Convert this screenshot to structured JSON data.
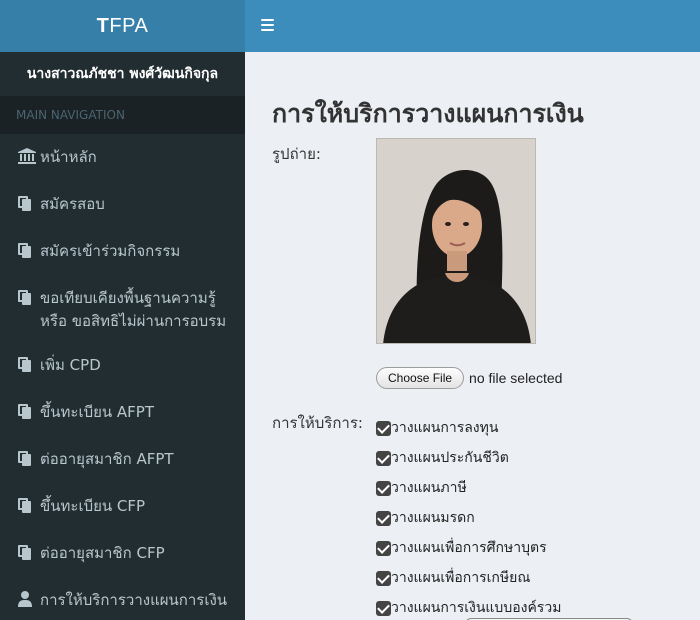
{
  "brand": {
    "first": "T",
    "rest": "FPA"
  },
  "user": {
    "name": "นางสาวณภัชชา พงศ์วัฒนกิจกุล"
  },
  "nav": {
    "header": "MAIN NAVIGATION",
    "items": [
      {
        "icon": "bank-icon",
        "label": "หน้าหลัก"
      },
      {
        "icon": "document-icon",
        "label": "สมัครสอบ"
      },
      {
        "icon": "document-icon",
        "label": "สมัครเข้าร่วมกิจกรรม"
      },
      {
        "icon": "document-icon",
        "label_line1": "ขอเทียบเคียงพื้นฐานความรู้",
        "label_line2": "หรือ ขอสิทธิไม่ผ่านการอบรม"
      },
      {
        "icon": "document-icon",
        "label": "เพิ่ม CPD"
      },
      {
        "icon": "document-icon",
        "label": "ขึ้นทะเบียน AFPT"
      },
      {
        "icon": "document-icon",
        "label": "ต่ออายุสมาชิก AFPT"
      },
      {
        "icon": "document-icon",
        "label": "ขึ้นทะเบียน CFP"
      },
      {
        "icon": "document-icon",
        "label": "ต่ออายุสมาชิก CFP"
      },
      {
        "icon": "user-icon",
        "label": "การให้บริการวางแผนการเงิน"
      }
    ]
  },
  "page": {
    "title": "การให้บริการวางแผนการเงิน",
    "photo_label": "รูปถ่าย:",
    "file_button": "Choose File",
    "file_status": "no file selected",
    "services_label": "การให้บริการ:",
    "services": [
      {
        "label": "วางแผนการลงทุน",
        "checked": true
      },
      {
        "label": "วางแผนประกันชีวิต",
        "checked": true
      },
      {
        "label": "วางแผนภาษี",
        "checked": true
      },
      {
        "label": "วางแผนมรดก",
        "checked": true
      },
      {
        "label": "วางแผนเพื่อการศึกษาบุตร",
        "checked": true
      },
      {
        "label": "วางแผนเพื่อการเกษียณ",
        "checked": true
      },
      {
        "label": "วางแผนการเงินแบบองค์รวม",
        "checked": true
      }
    ]
  },
  "colors": {
    "header": "#3c8dbc",
    "logo_bg": "#367fa9",
    "sidebar": "#222d32",
    "content_bg": "#ecf0f5"
  }
}
